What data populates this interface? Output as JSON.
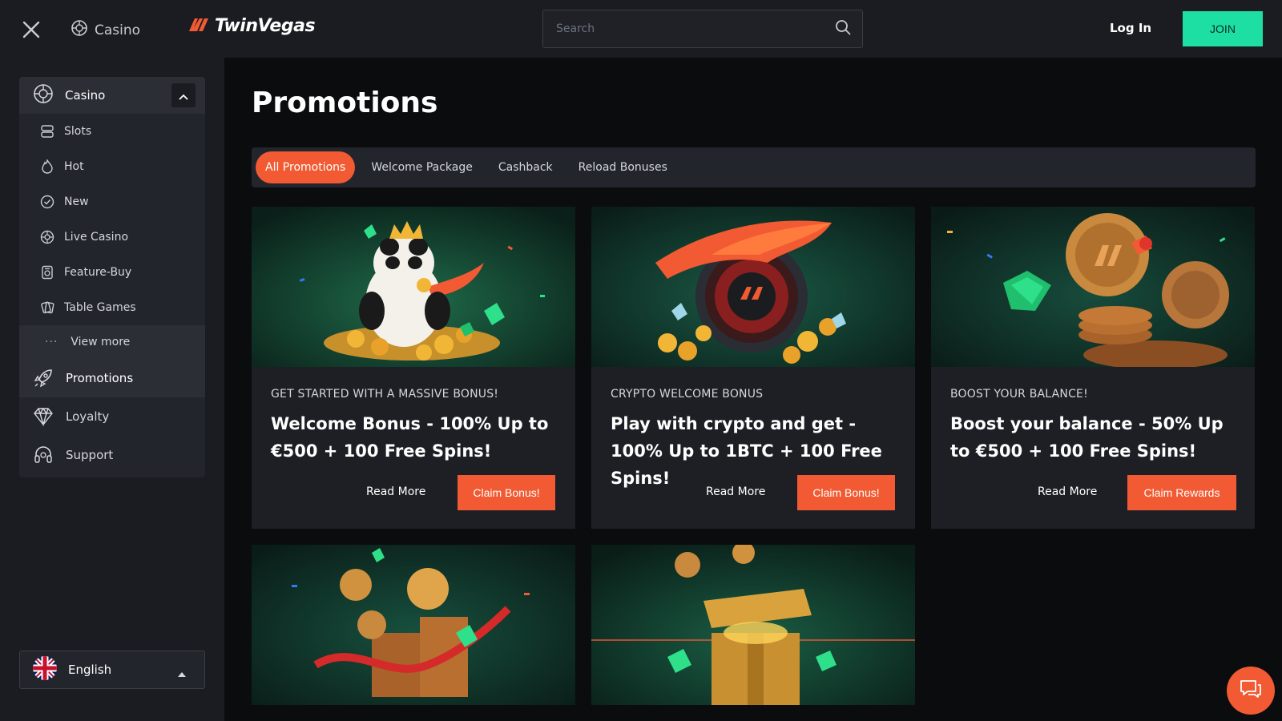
{
  "header": {
    "close_icon": "close-icon",
    "casino_label": "Casino",
    "logo_text": "TwinVegas",
    "search_placeholder": "Search",
    "login_label": "Log In",
    "join_label": "JOIN"
  },
  "sidebar": {
    "section_label": "Casino",
    "items": [
      {
        "label": "Slots",
        "icon": "slots-icon"
      },
      {
        "label": "Hot",
        "icon": "flame-icon"
      },
      {
        "label": "New",
        "icon": "new-badge-icon"
      },
      {
        "label": "Live Casino",
        "icon": "live-casino-icon"
      },
      {
        "label": "Feature-Buy",
        "icon": "feature-buy-icon"
      },
      {
        "label": "Table Games",
        "icon": "table-games-icon"
      }
    ],
    "view_more": "View more",
    "promotions": "Promotions",
    "loyalty": "Loyalty",
    "support": "Support",
    "language": "English"
  },
  "main": {
    "title": "Promotions",
    "tabs": [
      {
        "label": "All Promotions",
        "active": true
      },
      {
        "label": "Welcome Package",
        "active": false
      },
      {
        "label": "Cashback",
        "active": false
      },
      {
        "label": "Reload Bonuses",
        "active": false
      }
    ],
    "cards": [
      {
        "eyebrow": "GET STARTED WITH A MASSIVE BONUS!",
        "headline": "Welcome Bonus - 100% Up to €500 + 100 Free Spins!",
        "read_more": "Read More",
        "cta": "Claim Bonus!",
        "image": "panda-with-crown-and-coins"
      },
      {
        "eyebrow": "CRYPTO WELCOME BONUS",
        "headline": "Play with crypto and get - 100% Up to 1BTC + 100 Free Spins!",
        "read_more": "Read More",
        "cta": "Claim Bonus!",
        "image": "roulette-wheel-with-cape"
      },
      {
        "eyebrow": "BOOST YOUR BALANCE!",
        "headline": "Boost your balance - 50% Up to €500 + 100 Free Spins!",
        "read_more": "Read More",
        "cta": "Claim Rewards",
        "image": "coin-stack-with-bow"
      }
    ],
    "more_cards": [
      {
        "image": "coin-stacks-with-ribbon"
      },
      {
        "image": "golden-gift-box"
      }
    ]
  },
  "colors": {
    "accent": "#f15a32",
    "join": "#1ddfa4",
    "panel": "#22252b",
    "background": "#0b0c0e"
  }
}
